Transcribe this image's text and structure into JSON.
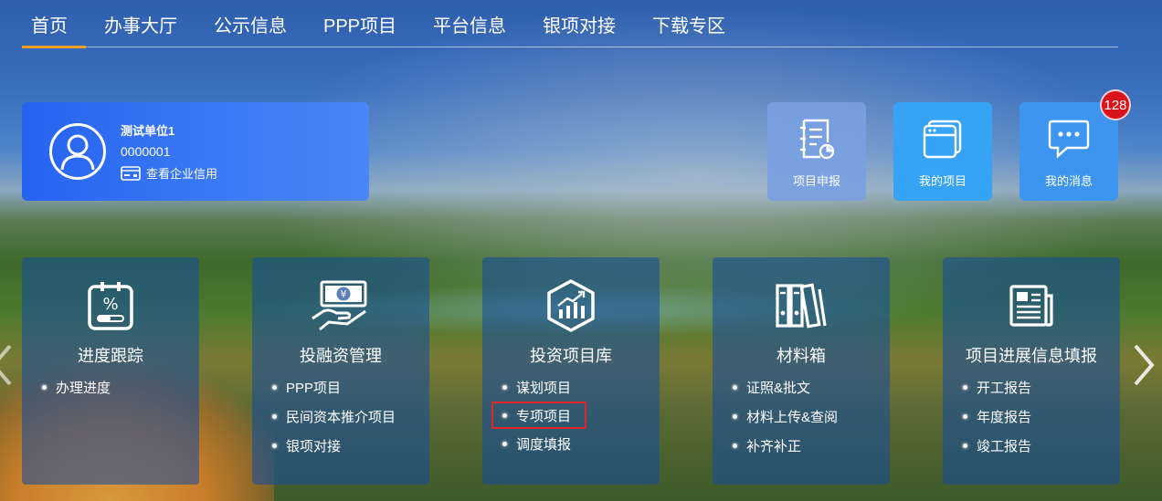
{
  "nav": {
    "items": [
      {
        "label": "首页"
      },
      {
        "label": "办事大厅"
      },
      {
        "label": "公示信息"
      },
      {
        "label": "PPP项目"
      },
      {
        "label": "平台信息"
      },
      {
        "label": "银项对接"
      },
      {
        "label": "下载专区"
      }
    ],
    "active_index": 0,
    "accent": "#f0a020"
  },
  "user": {
    "name": "测试单位1",
    "code": "0000001",
    "credit_link": "查看企业信用",
    "card_color": "#2663f0"
  },
  "quick_tiles": [
    {
      "label": "项目申报",
      "icon": "report-doc-icon"
    },
    {
      "label": "我的项目",
      "icon": "folder-stack-icon"
    },
    {
      "label": "我的消息",
      "icon": "message-bubble-icon",
      "badge": "128"
    }
  ],
  "panels": [
    {
      "title": "进度跟踪",
      "icon": "progress-clipboard-icon",
      "items": [
        "办理进度"
      ]
    },
    {
      "title": "投融资管理",
      "icon": "money-hand-icon",
      "items": [
        "PPP项目",
        "民间资本推介项目",
        "银项对接"
      ]
    },
    {
      "title": "投资项目库",
      "icon": "chart-hexagon-icon",
      "items": [
        "谋划项目",
        "专项项目",
        "调度填报"
      ],
      "highlighted_item": 1
    },
    {
      "title": "材料箱",
      "icon": "binders-icon",
      "items": [
        "证照&批文",
        "材料上传&查阅",
        "补齐补正"
      ]
    },
    {
      "title": "项目进展信息填报",
      "icon": "newspaper-icon",
      "items": [
        "开工报告",
        "年度报告",
        "竣工报告"
      ]
    }
  ],
  "highlight_color": "#e3262b"
}
